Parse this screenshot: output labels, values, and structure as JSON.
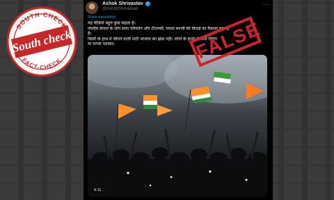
{
  "post": {
    "author_name": "Ashok Shrivastav",
    "author_handle": "@AshokShrivasta6",
    "verified_icon": "verified-check-icon",
    "translate_label": "Show translation",
    "text_lines": [
      "यह वीडियो बहुत कुछ कहता है।",
      "पश्चिम बंगाल के लोग सत्ता परिवर्तन और टीएमसी, ममता बनर्जी की विदाई का फैसला कर रहे",
      "हैं।",
      "किसी के हाथ में जीतने वाली पार्टी भाजपा का झंडा नहीं। लोगों के हाथों में सिर्फ तिरंगा",
      "या भगवा पताका।"
    ],
    "video_time": "0:11"
  },
  "logo": {
    "top_text": "SOUTH CHECK",
    "bottom_text": "FACT-CHECK",
    "brand_text": "South Check",
    "color": "#c62828"
  },
  "verdict": {
    "label": "FALSE",
    "color": "#d1232a"
  }
}
